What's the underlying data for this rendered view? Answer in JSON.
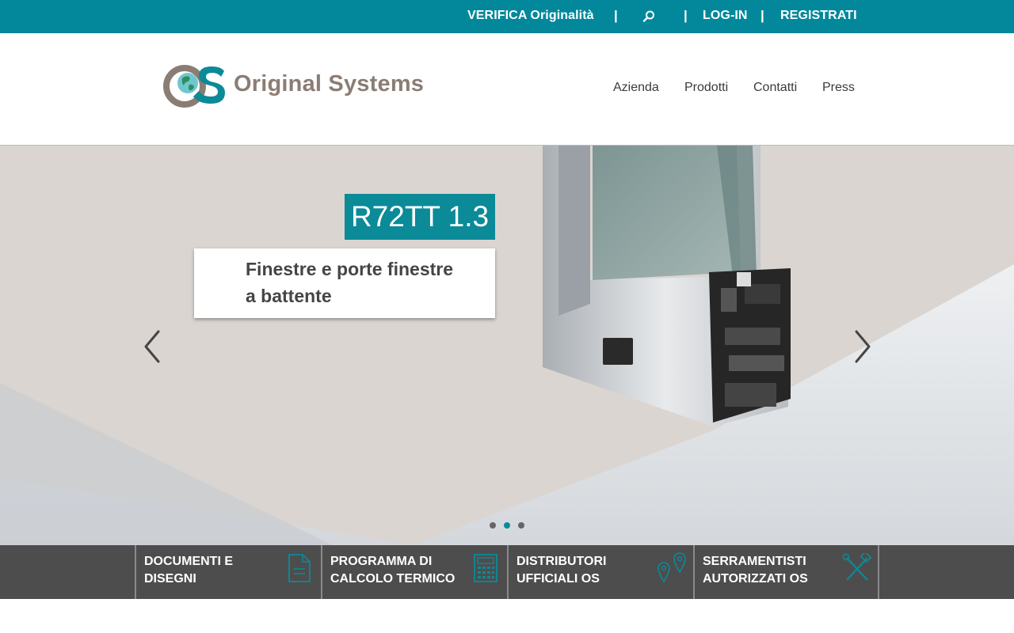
{
  "topbar": {
    "verify_label": "VERIFICA Originalità",
    "separator": "|",
    "login_label": "LOG-IN",
    "register_label": "REGISTRATI"
  },
  "header": {
    "logo_text": "Original Systems",
    "logo_mark_letters": "OS",
    "nav": [
      "Azienda",
      "Prodotti",
      "Contatti",
      "Press"
    ]
  },
  "hero": {
    "title": "R72TT 1.3",
    "subtitle_line1": "Finestre e porte finestre",
    "subtitle_line2": "a battente",
    "slide_count": 3,
    "active_slide": 2
  },
  "quicklinks": [
    {
      "line1": "DOCUMENTI E",
      "line2": "DISEGNI",
      "icon": "document-icon"
    },
    {
      "line1": "PROGRAMMA DI",
      "line2": "CALCOLO TERMICO",
      "icon": "calculator-icon"
    },
    {
      "line1": "DISTRIBUTORI",
      "line2": "UFFICIALI OS",
      "icon": "map-pin-icon"
    },
    {
      "line1": "SERRAMENTISTI",
      "line2": "AUTORIZZATI OS",
      "icon": "tools-icon"
    }
  ],
  "colors": {
    "brand_teal": "#02889a",
    "brand_taupe": "#8b7d74",
    "dark_bar": "#4d4d4d"
  }
}
